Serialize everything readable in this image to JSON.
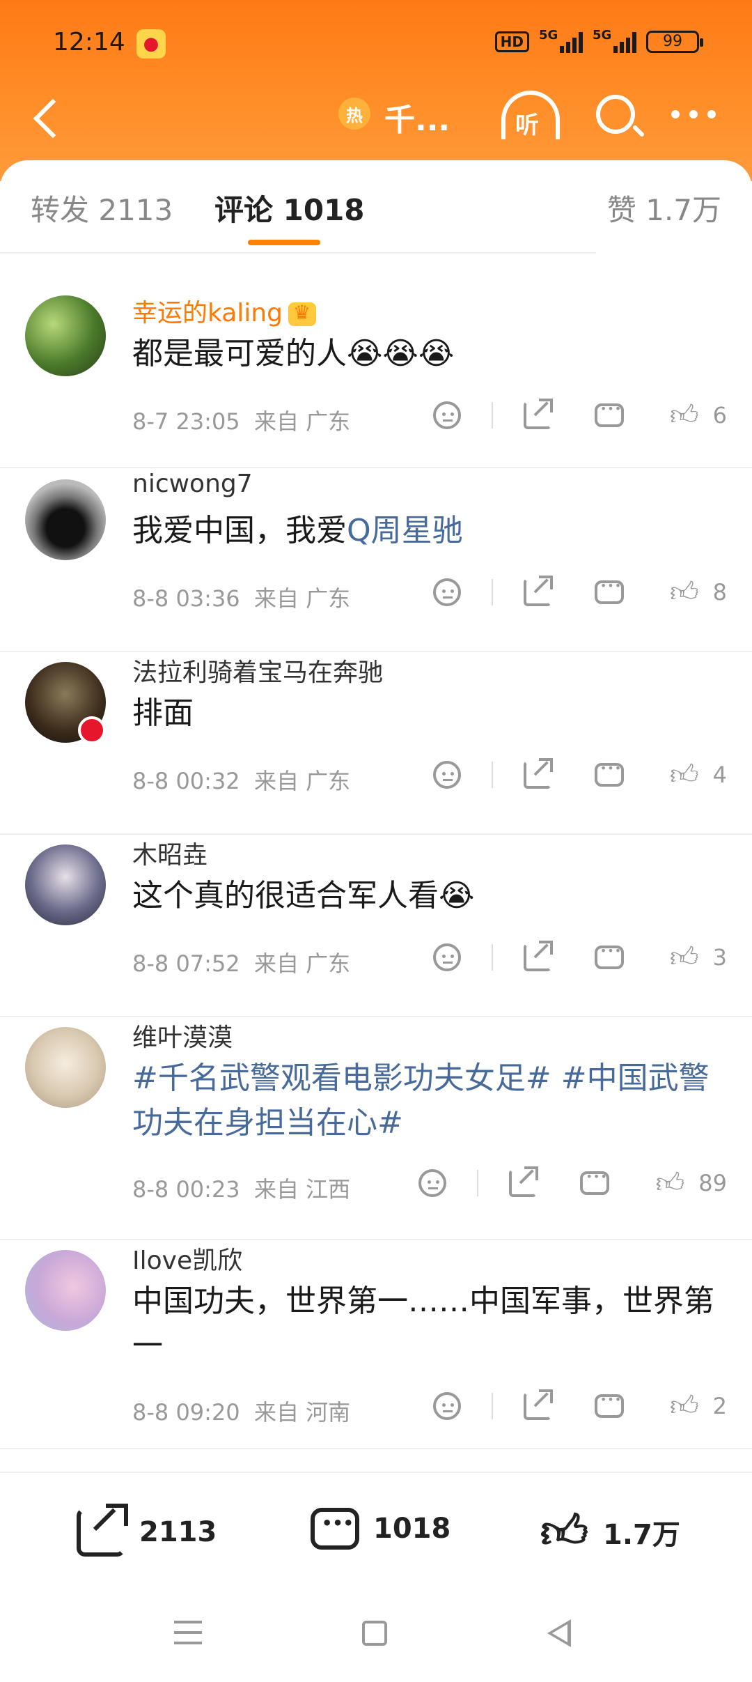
{
  "status": {
    "time": "12:14",
    "hd": "HD",
    "sig1": "5G",
    "sig2": "5G",
    "battery": "99"
  },
  "nav": {
    "hot_badge": "热",
    "topic_title": "千...",
    "listen_label": "听"
  },
  "tabs": {
    "repost": "转发 2113",
    "comments": "评论 1018",
    "likes": "赞 1.7万"
  },
  "comments": [
    {
      "user": "幸运的kaling",
      "text": "都是最可爱的人😭😭😭",
      "time": "8-7 23:05",
      "location": "来自 广东",
      "likes": "6"
    },
    {
      "user": "nicwong7",
      "text": "我爱中国，我爱",
      "link": "Q周星驰",
      "time": "8-8 03:36",
      "location": "来自 广东",
      "likes": "8"
    },
    {
      "user": "法拉利骑着宝马在奔驰",
      "text": "排面",
      "time": "8-8 00:32",
      "location": "来自 广东",
      "likes": "4"
    },
    {
      "user": "木昭垚",
      "text": "这个真的很适合军人看😭",
      "time": "8-8 07:52",
      "location": "来自 广东",
      "likes": "3"
    },
    {
      "user": "维叶漠漠",
      "text": "#千名武警观看电影功夫女足# #中国武警功夫在身担当在心#",
      "time": "8-8 00:23",
      "location": "来自 江西",
      "likes": "89"
    },
    {
      "user": "Ilove凯欣",
      "text": "中国功夫，世界第一……中国军事，世界第一",
      "time": "8-8 09:20",
      "location": "来自 河南",
      "likes": "2"
    }
  ],
  "bottom": {
    "repost": "2113",
    "comments": "1018",
    "likes": "1.7万"
  },
  "colors": {
    "accent": "#ff8200",
    "link": "#486a9a",
    "vip_name": "#ff7a00"
  }
}
